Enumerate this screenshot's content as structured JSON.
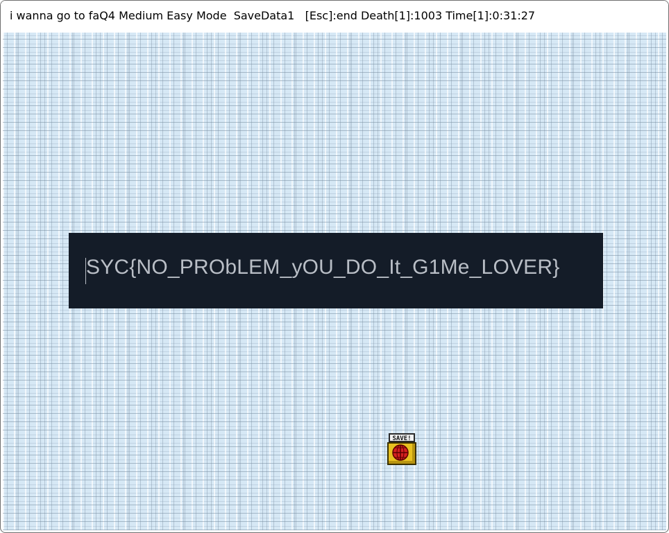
{
  "window": {
    "title": "i wanna go to faQ4 Medium Easy Mode  SaveData1   [Esc]:end Death[1]:1003 Time[1]:0:31:27"
  },
  "game": {
    "flag_text": "SYC{NO_PRObLEM_yOU_DO_It_G1Me_LOVER}",
    "save_label": "SAVE!",
    "colors": {
      "background": "#d6e8f5",
      "flag_box": "#141c28",
      "flag_text": "#b9bec6",
      "save_box": "#e8c020",
      "save_orb": "#d42020"
    }
  }
}
